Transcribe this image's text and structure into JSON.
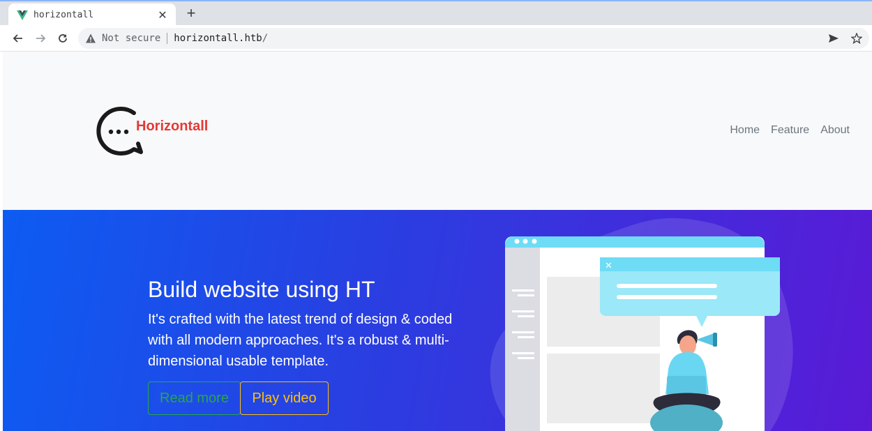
{
  "browser": {
    "tab_title": "horizontall",
    "address_warning": "Not secure",
    "url_host": "horizontall.htb",
    "url_path": "/"
  },
  "site": {
    "brand": "Horizontall",
    "nav": [
      "Home",
      "Feature",
      "About"
    ]
  },
  "hero": {
    "title": "Build website using HT",
    "description": "It's crafted with the latest trend of design & coded with all modern approaches. It's a robust & multi-dimensional usable template.",
    "read_more": "Read more",
    "play_video": "Play video"
  },
  "colors": {
    "brand_red": "#e53935",
    "hero_start": "#0d5cf2",
    "hero_end": "#5a1ad6",
    "read_more": "#28a745",
    "play_video": "#ffc107"
  }
}
